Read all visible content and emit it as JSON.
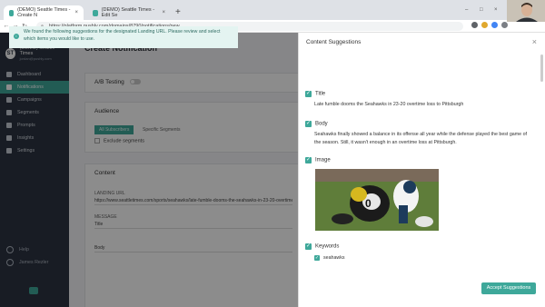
{
  "browser": {
    "tabs": [
      {
        "label": "(DEMO) Seattle Times - Create N"
      },
      {
        "label": "(DEMO) Seattle Times - Edit Se"
      }
    ],
    "url": "https://platform.pushly.com/domains/8790/notifications/new"
  },
  "sidebar": {
    "brand_name": "(DEMO) Seattle Times",
    "brand_email": "jordan@pushly.com",
    "items": [
      {
        "label": "Dashboard"
      },
      {
        "label": "Notifications"
      },
      {
        "label": "Campaigns"
      },
      {
        "label": "Segments"
      },
      {
        "label": "Prompts"
      },
      {
        "label": "Insights"
      },
      {
        "label": "Settings"
      }
    ],
    "bottom": [
      {
        "label": "Help"
      },
      {
        "label": "James Rezler"
      }
    ]
  },
  "main": {
    "title": "Create Notification",
    "ab_label": "A/B Testing",
    "audience_label": "Audience",
    "seg_all": "All Subscribers",
    "seg_specific": "Specific Segments",
    "exclude_label": "Exclude segments",
    "content_label": "Content",
    "landing_label": "LANDING URL",
    "landing_value": "https://www.seattletimes.com/sports/seahawks/late-fumble-dooms-the-seahawks-in-23-20-overtime-loss-to-pittsburgh/",
    "message_label": "MESSAGE",
    "title_label": "Title",
    "body_label": "Body"
  },
  "panel": {
    "heading": "Content Suggestions",
    "info": "We found the following suggestions for the designated Landing URL. Please review and select which items you would like to use.",
    "sections": {
      "title": {
        "label": "Title",
        "value": "Late fumble dooms the Seahawks in 23-20 overtime loss to Pittsburgh"
      },
      "body": {
        "label": "Body",
        "value": "Seahawks finally showed a balance in its offense all year while the defense played the best game of the season. Still, it wasn't enough in an overtime loss at Pittsburgh."
      },
      "image": {
        "label": "Image"
      },
      "keywords": {
        "label": "Keywords",
        "items": [
          "seahawks"
        ]
      }
    },
    "accept_label": "Accept Suggestions"
  },
  "colors": {
    "accent": "#3ea89a",
    "sidebar": "#2c3443"
  }
}
